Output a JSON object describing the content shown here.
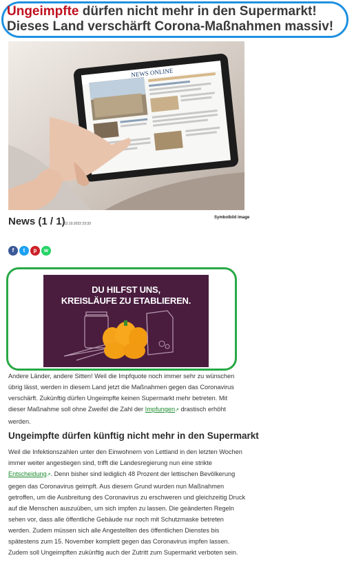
{
  "headline": {
    "highlight": "Ungeimpfte",
    "rest": " dürfen nicht mehr in den Supermarkt! Dieses Land verschärft Corona-Maßnahmen massiv!"
  },
  "hero": {
    "tablet_brand": "NEWS ONLINE"
  },
  "caption": "Symbolbild image",
  "news": {
    "title": "News (1 / 1)",
    "date": "12.10.2022 23:33"
  },
  "share": {
    "facebook": "f",
    "twitter": "t",
    "pinterest": "p",
    "whatsapp": "w"
  },
  "ad": {
    "line1": "DU HILFST UNS,",
    "line2": "KREISLÄUFE ZU ETABLIEREN."
  },
  "article": {
    "p1_a": "Andere Länder, andere Sitten! Weil die Impfquote noch immer sehr zu wünschen übrig lässt, werden in diesem Land jetzt die Maßnahmen gegen das Coronavirus verschärft. Zukünftig dürfen Ungeimpfte keinen Supermarkt mehr betreten. Mit dieser Maßnahme soll ohne Zweifel die Zahl der ",
    "p1_link": "Impfungen",
    "p1_b": " drastisch erhöht werden.",
    "heading": "Ungeimpfte dürfen künftig nicht mehr in den Supermarkt",
    "p2_a": "Weil die Infektionszahlen unter den Einwohnern von Lettland in den letzten Wochen immer weiter angestiegen sind, trifft die Landesregierung nun eine strikte ",
    "p2_link": "Entscheidung",
    "p2_b": ". Denn bisher sind lediglich 48 Prozent der lettischen Bevölkerung gegen das Coronavirus geimpft. Aus diesem Grund wurden nun Maßnahmen getroffen, um die Ausbreitung des Coronavirus zu erschweren und gleichzeitig Druck auf die Menschen auszuüben, um sich impfen zu lassen. Die geänderten Regeln sehen vor, dass alle öffentliche Gebäude nur noch mit Schutzmaske betreten werden. Zudem müssen sich alle Angestellten des öffentlichen Dienstes bis spätestens zum 15. November komplett gegen das Coronavirus impfen lassen. Zudem soll Ungeimpften zukünftig auch der Zutritt zum Supermarkt verboten sein."
  },
  "colors": {
    "accent_red": "#c0101e",
    "link_green": "#1a8a2b",
    "headline_border": "#1e90e0",
    "ad_border": "#27a844",
    "ad_bg": "#4a1d3f"
  }
}
